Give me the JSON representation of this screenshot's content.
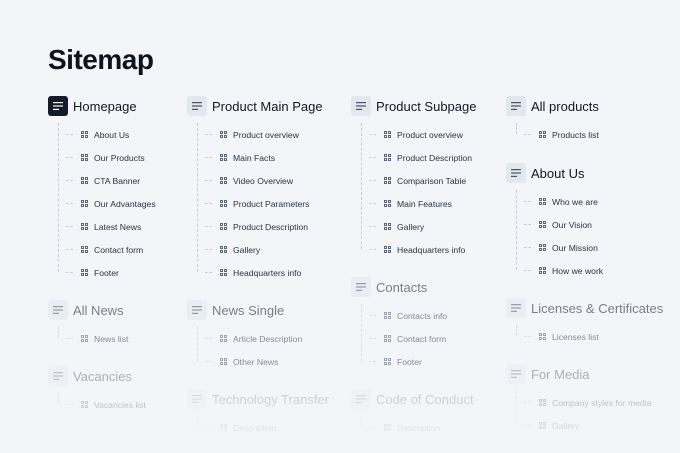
{
  "page": {
    "title": "Sitemap"
  },
  "sections": {
    "homepage": {
      "label": "Homepage",
      "items": [
        "About Us",
        "Our Products",
        "CTA Banner",
        "Our Advantages",
        "Latest News",
        "Contact form",
        "Footer"
      ]
    },
    "product_main": {
      "label": "Product Main Page",
      "items": [
        "Product overview",
        "Main Facts",
        "Video Overview",
        "Product Parameters",
        "Product Description",
        "Gallery",
        "Headquarters info"
      ]
    },
    "product_sub": {
      "label": "Product Subpage",
      "items": [
        "Product overview",
        "Product Description",
        "Comparison Table",
        "Main Features",
        "Gallery",
        "Headquarters info"
      ]
    },
    "all_products": {
      "label": "All products",
      "items": [
        "Products list"
      ]
    },
    "about_us": {
      "label": "About Us",
      "items": [
        "Who we are",
        "Our Vision",
        "Our Mission",
        "How we work"
      ]
    },
    "all_news": {
      "label": "All News",
      "items": [
        "News list"
      ]
    },
    "news_single": {
      "label": "News Single",
      "items": [
        "Article Description",
        "Other News"
      ]
    },
    "contacts": {
      "label": "Contacts",
      "items": [
        "Contacts info",
        "Contact form",
        "Footer"
      ]
    },
    "licenses": {
      "label": "Licenses & Certificates",
      "items": [
        "Licenses list"
      ]
    },
    "vacancies": {
      "label": "Vacancies",
      "items": [
        "Vacancies list"
      ]
    },
    "tech_transfer": {
      "label": "Technology Transfer",
      "items": [
        "Description"
      ]
    },
    "code_conduct": {
      "label": "Code of Conduct",
      "items": [
        "Description"
      ]
    },
    "for_media": {
      "label": "For Media",
      "items": [
        "Company styles for media",
        "Gallery"
      ]
    }
  },
  "colors": {
    "background": "#f3f5f8",
    "icon_dark": "#131a2a",
    "icon_light": "#e3e8ef"
  },
  "icons": {
    "section": "document-lines-icon",
    "item": "grid-icon"
  }
}
